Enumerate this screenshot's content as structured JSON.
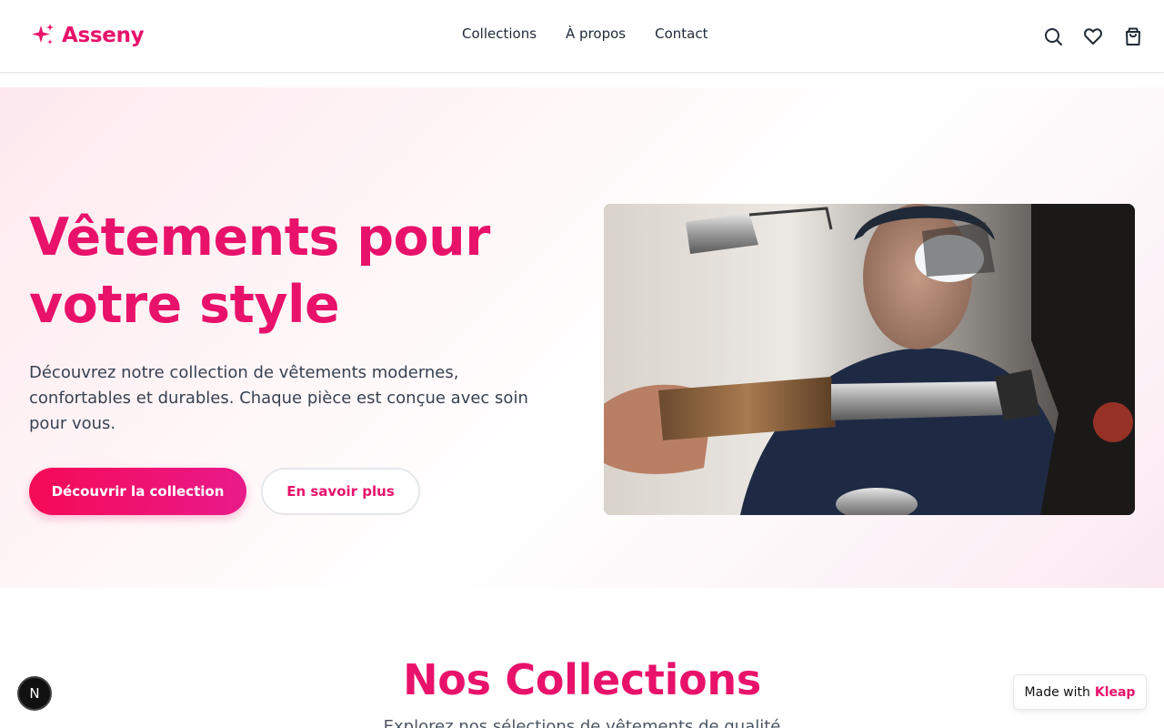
{
  "header": {
    "brand": "Asseny",
    "nav": [
      "Collections",
      "À propos",
      "Contact"
    ],
    "icons": [
      "search-icon",
      "heart-icon",
      "shopping-bag-icon"
    ]
  },
  "hero": {
    "title": "Vêtements pour votre style",
    "description": "Découvrez notre collection de vêtements modernes, confortables et durables. Chaque pièce est conçue avec soin pour vous.",
    "primary_cta": "Découvrir la collection",
    "secondary_cta": "En savoir plus"
  },
  "collections": {
    "title": "Nos Collections",
    "subtitle": "Explorez nos sélections de vêtements de qualité"
  },
  "badge": {
    "letter": "N"
  },
  "made_with": {
    "prefix": "Made with",
    "brand": "Kleap"
  },
  "colors": {
    "accent": "#e8126b",
    "text": "#1f2937"
  }
}
